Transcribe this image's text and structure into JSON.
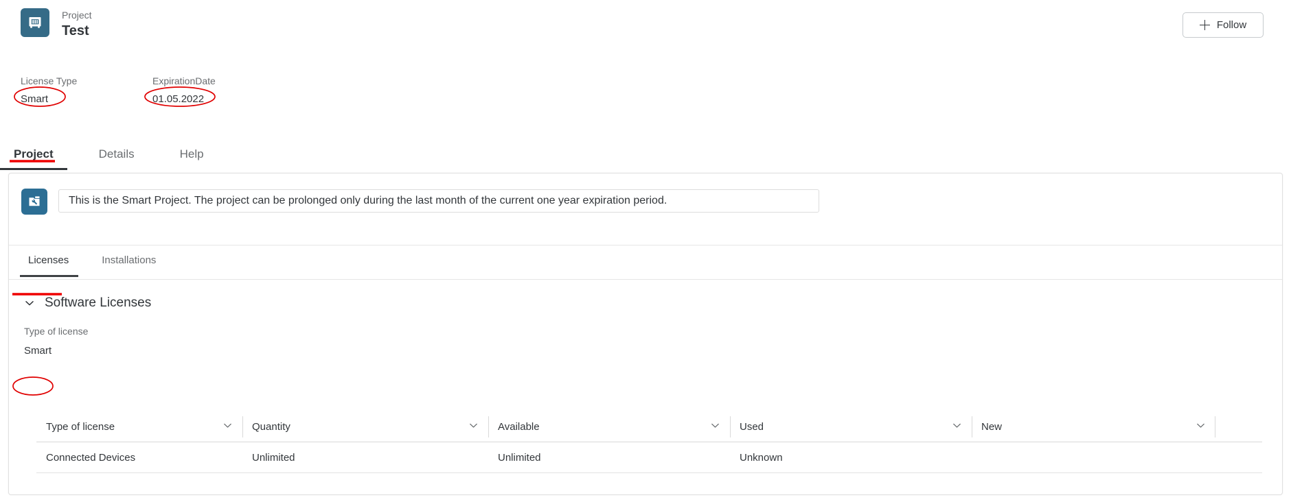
{
  "header": {
    "supertitle": "Project",
    "title": "Test",
    "icon": "safe-vault-icon",
    "follow_label": "Follow",
    "follow_icon": "plus-icon"
  },
  "attributes": [
    {
      "label": "License Type",
      "value": "Smart"
    },
    {
      "label": "ExpirationDate",
      "value": "01.05.2022"
    }
  ],
  "main_tabs": [
    {
      "label": "Project",
      "selected": true
    },
    {
      "label": "Details",
      "selected": false
    },
    {
      "label": "Help",
      "selected": false
    }
  ],
  "message": {
    "icon": "project-tools-icon",
    "text": "This is the Smart Project. The project can be prolonged only during the last month of the current one year expiration period."
  },
  "inner_tabs": [
    {
      "label": "Licenses",
      "selected": true
    },
    {
      "label": "Installations",
      "selected": false
    }
  ],
  "section": {
    "title": "Software Licenses",
    "expand_icon": "chevron-down-icon",
    "field_label": "Type of license",
    "field_value": "Smart"
  },
  "table": {
    "columns": [
      "Type of license",
      "Quantity",
      "Available",
      "Used",
      "New"
    ],
    "sort_icon": "chevron-down-icon",
    "rows": [
      {
        "type_of_license": "Connected Devices",
        "quantity": "Unlimited",
        "available": "Unlimited",
        "used": "Unknown",
        "new": ""
      }
    ]
  },
  "colors": {
    "brand_icon": "#356b87",
    "message_icon": "#2c6e94",
    "annotation_red": "#e00000",
    "underline_red": "#ef0000",
    "label_gray": "#6a6d70",
    "text_dark": "#32363a"
  }
}
